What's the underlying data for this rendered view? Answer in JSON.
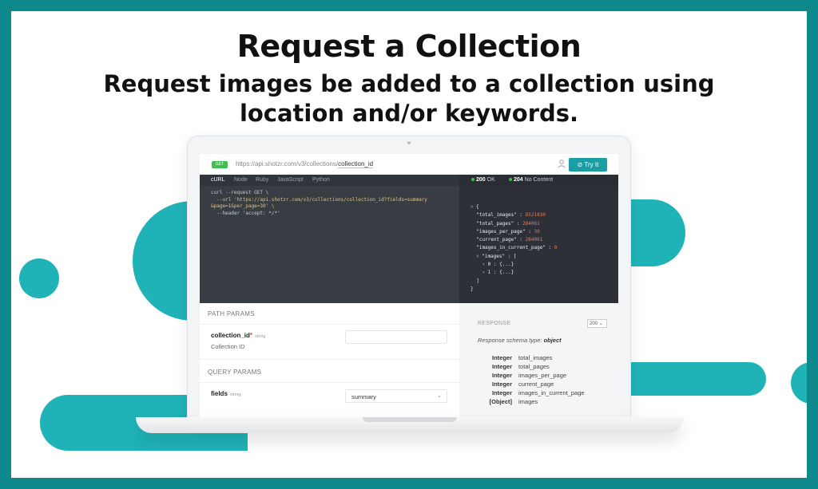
{
  "slide": {
    "title": "Request a Collection",
    "subtitle": "Request images be added to a collection using location and/or keywords."
  },
  "colors": {
    "teal_border": "#0e8a8c",
    "teal_blob": "#1fb3b8",
    "try_button": "#1a9ea3",
    "method_badge": "#3fbf4f"
  },
  "api": {
    "method": "GET",
    "url_base": "https://api.shotzr.com/v3/collections/",
    "url_param": "collection_id",
    "try_label": "Try It",
    "user_icon": "user-icon",
    "lang_tabs": [
      "cURL",
      "Node",
      "Ruby",
      "JavaScript",
      "Python"
    ],
    "code_lines": [
      "curl --request GET \\",
      "  --url 'https://api.shotzr.com/v3/collections/collection_id?fields=summary",
      "&page=1&per_page=30' \\",
      "  --header 'accept: */*'"
    ],
    "status_ok": "200",
    "status_ok_text": "OK",
    "status_nc": "204",
    "status_nc_text": "No Content",
    "json": {
      "l0": "˅ {",
      "total_images_key": "  \"total_images\" :",
      "total_images_val": "8521830",
      "total_pages_key": "  \"total_pages\" :",
      "total_pages_val": "284061",
      "images_per_page_key": "  \"images_per_page\" :",
      "images_per_page_val": "30",
      "current_page_key": "  \"current_page\" :",
      "current_page_val": "284061",
      "in_current_key": "  \"images_in_current_page\" :",
      "in_current_val": "0",
      "images_key": "  ˅ \"images\" : [",
      "item0": "    › 0 : {...}",
      "item1": "    › 1 : {...}",
      "close_arr": "  ]",
      "close_obj": "}"
    }
  },
  "params": {
    "path_header": "PATH PARAMS",
    "collection_id_name": "collection_id",
    "collection_id_req": "*",
    "collection_id_type": "string",
    "collection_id_desc": "Collection ID",
    "collection_id_value": "",
    "query_header": "QUERY PARAMS",
    "fields_name": "fields",
    "fields_type": "string",
    "fields_value": "summary"
  },
  "response": {
    "label": "RESPONSE",
    "code_select": "200",
    "schema_prefix": "Response schema type:",
    "schema_type": "object",
    "fields": [
      {
        "type": "Integer",
        "name": "total_images"
      },
      {
        "type": "Integer",
        "name": "total_pages"
      },
      {
        "type": "Integer",
        "name": "images_per_page"
      },
      {
        "type": "Integer",
        "name": "current_page"
      },
      {
        "type": "Integer",
        "name": "images_in_current_page"
      },
      {
        "type": "[Object]",
        "name": "images"
      }
    ]
  }
}
